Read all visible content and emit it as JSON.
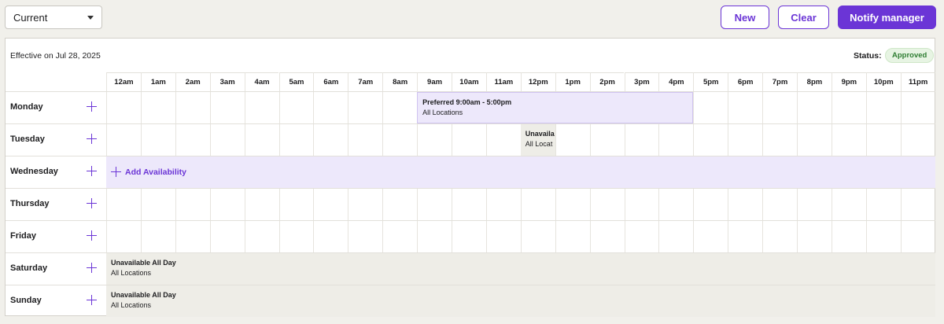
{
  "toolbar": {
    "period_select": "Current",
    "new_label": "New",
    "clear_label": "Clear",
    "notify_label": "Notify manager"
  },
  "panel": {
    "effective": "Effective on Jul 28, 2025",
    "status_label": "Status:",
    "status_value": "Approved"
  },
  "hours": [
    "12am",
    "1am",
    "2am",
    "3am",
    "4am",
    "5am",
    "6am",
    "7am",
    "8am",
    "9am",
    "10am",
    "11am",
    "12pm",
    "1pm",
    "2pm",
    "3pm",
    "4pm",
    "5pm",
    "6pm",
    "7pm",
    "8pm",
    "9pm",
    "10pm",
    "11pm"
  ],
  "days": [
    {
      "name": "Monday",
      "block": {
        "kind": "preferred",
        "title": "Preferred 9:00am - 5:00pm",
        "sub": "All Locations",
        "start": 9,
        "end": 17
      }
    },
    {
      "name": "Tuesday",
      "block": {
        "kind": "unavailable",
        "title": "Unavaila",
        "sub": "All Locat",
        "start": 12,
        "end": 13
      }
    },
    {
      "name": "Wednesday",
      "block": {
        "kind": "add",
        "title": "Add Availability",
        "start": 0,
        "end": 24
      }
    },
    {
      "name": "Thursday"
    },
    {
      "name": "Friday"
    },
    {
      "name": "Saturday",
      "block": {
        "kind": "unavailable",
        "title": "Unavailable All Day",
        "sub": "All Locations",
        "start": 0,
        "end": 24
      }
    },
    {
      "name": "Sunday",
      "block": {
        "kind": "unavailable",
        "title": "Unavailable All Day",
        "sub": "All Locations",
        "start": 0,
        "end": 24
      }
    }
  ],
  "colors": {
    "accent": "#6b35d6",
    "approved": "#2e7d32"
  }
}
